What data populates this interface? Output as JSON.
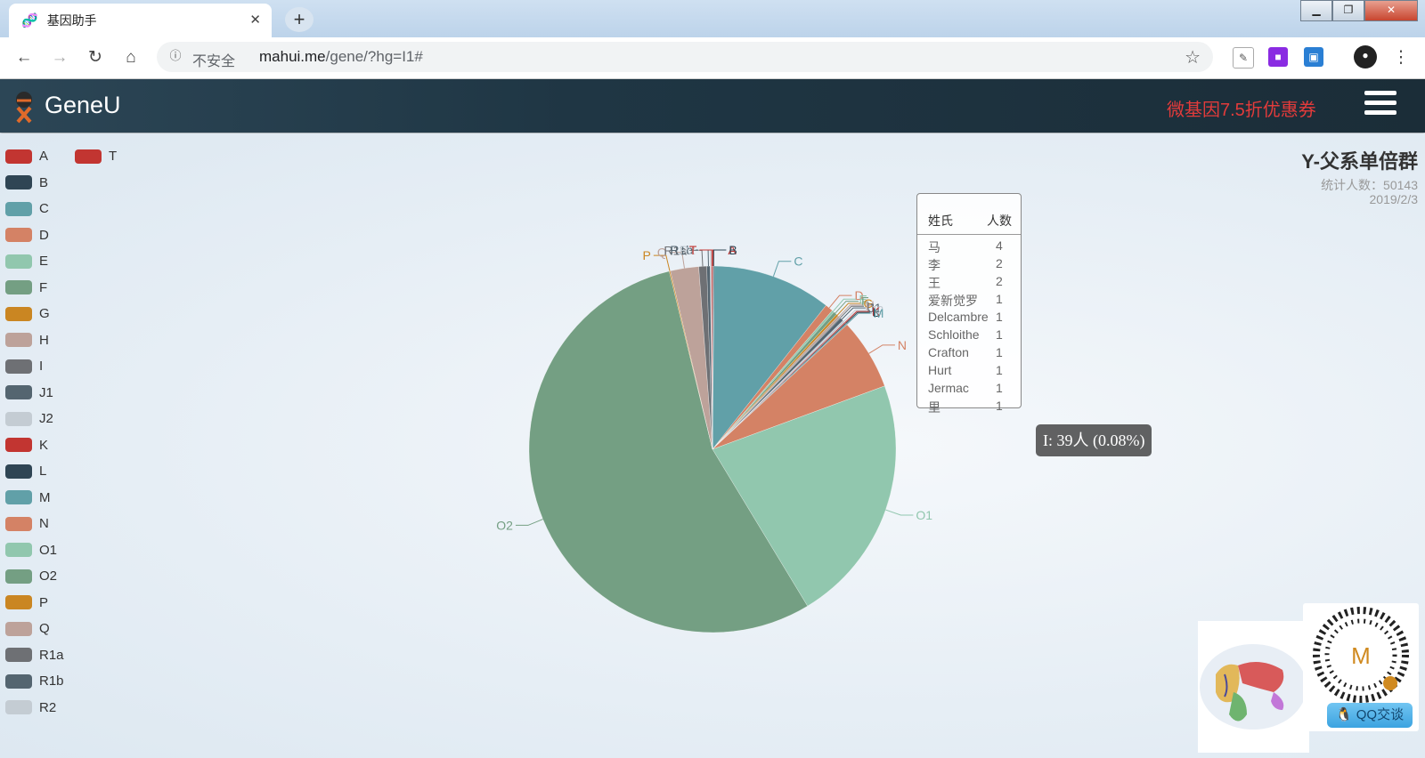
{
  "browser": {
    "tab_title": "基因助手",
    "insecure_label": "不安全",
    "url_host": "mahui.me",
    "url_path": "/gene/?hg=I1#"
  },
  "header": {
    "brand": "GeneU",
    "promo": "微基因7.5折优惠券"
  },
  "chart_header": {
    "title": "Y-父系单倍群",
    "stat": "统计人数：50143",
    "date": "2019/2/3"
  },
  "legend": [
    {
      "label": "A",
      "color": "#c23531"
    },
    {
      "label": "B",
      "color": "#2f4554"
    },
    {
      "label": "C",
      "color": "#61a0a8"
    },
    {
      "label": "D",
      "color": "#d48265"
    },
    {
      "label": "E",
      "color": "#91c7ae"
    },
    {
      "label": "F",
      "color": "#749f83"
    },
    {
      "label": "G",
      "color": "#ca8622"
    },
    {
      "label": "H",
      "color": "#bda29a"
    },
    {
      "label": "I",
      "color": "#6e7074"
    },
    {
      "label": "J1",
      "color": "#546570"
    },
    {
      "label": "J2",
      "color": "#c4ccd3"
    },
    {
      "label": "K",
      "color": "#c23531"
    },
    {
      "label": "L",
      "color": "#2f4554"
    },
    {
      "label": "M",
      "color": "#61a0a8"
    },
    {
      "label": "N",
      "color": "#d48265"
    },
    {
      "label": "O1",
      "color": "#91c7ae"
    },
    {
      "label": "O2",
      "color": "#749f83"
    },
    {
      "label": "P",
      "color": "#ca8622"
    },
    {
      "label": "Q",
      "color": "#bda29a"
    },
    {
      "label": "R1a",
      "color": "#6e7074"
    },
    {
      "label": "R1b",
      "color": "#546570"
    },
    {
      "label": "R2",
      "color": "#c4ccd3"
    },
    {
      "label": "T",
      "color": "#c23531"
    }
  ],
  "chart_data": {
    "type": "pie",
    "title": "Y-父系单倍群",
    "slices": [
      {
        "name": "A",
        "percent": 0.05,
        "color": "#c23531"
      },
      {
        "name": "B",
        "percent": 0.1,
        "color": "#2f4554"
      },
      {
        "name": "C",
        "percent": 10.5,
        "color": "#61a0a8"
      },
      {
        "name": "D",
        "percent": 0.7,
        "color": "#d48265"
      },
      {
        "name": "E",
        "percent": 0.2,
        "color": "#91c7ae"
      },
      {
        "name": "F",
        "percent": 0.3,
        "color": "#749f83"
      },
      {
        "name": "G",
        "percent": 0.2,
        "color": "#ca8622"
      },
      {
        "name": "H",
        "percent": 0.2,
        "color": "#bda29a"
      },
      {
        "name": "I",
        "percent": 0.08,
        "color": "#6e7074"
      },
      {
        "name": "J1",
        "percent": 0.3,
        "color": "#546570"
      },
      {
        "name": "J2",
        "percent": 0.2,
        "color": "#c4ccd3"
      },
      {
        "name": "K",
        "percent": 0.1,
        "color": "#c23531"
      },
      {
        "name": "L",
        "percent": 0.1,
        "color": "#2f4554"
      },
      {
        "name": "M",
        "percent": 0.1,
        "color": "#61a0a8"
      },
      {
        "name": "N",
        "percent": 6.3,
        "color": "#d48265"
      },
      {
        "name": "O1",
        "percent": 22.0,
        "color": "#91c7ae"
      },
      {
        "name": "O2",
        "percent": 55.0,
        "color": "#749f83"
      },
      {
        "name": "P",
        "percent": 0.1,
        "color": "#ca8622"
      },
      {
        "name": "Q",
        "percent": 2.5,
        "color": "#bda29a"
      },
      {
        "name": "R1a",
        "percent": 0.7,
        "color": "#6e7074"
      },
      {
        "name": "R1b",
        "percent": 0.3,
        "color": "#546570"
      },
      {
        "name": "R2",
        "percent": 0.1,
        "color": "#c4ccd3"
      },
      {
        "name": "T",
        "percent": 0.1,
        "color": "#c23531"
      }
    ]
  },
  "surname_table": {
    "col_surname": "姓氏",
    "col_count": "人数",
    "rows": [
      {
        "name": "马",
        "count": "4"
      },
      {
        "name": "李",
        "count": "2"
      },
      {
        "name": "王",
        "count": "2"
      },
      {
        "name": "爱新觉罗",
        "count": "1"
      },
      {
        "name": "Delcambre",
        "count": "1"
      },
      {
        "name": "Schloithe",
        "count": "1"
      },
      {
        "name": "Crafton",
        "count": "1"
      },
      {
        "name": "Hurt",
        "count": "1"
      },
      {
        "name": "Jermac",
        "count": "1"
      },
      {
        "name": "里",
        "count": "1"
      }
    ]
  },
  "hover_tooltip": "I: 39人 (0.08%)",
  "qq_button": "QQ交谈",
  "qr_center": "M"
}
